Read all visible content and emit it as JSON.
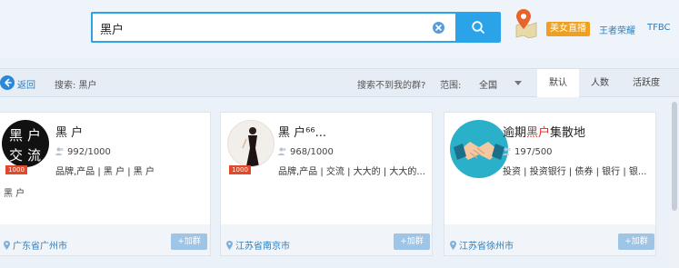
{
  "search": {
    "value": "黑户"
  },
  "top_links": {
    "live_badge": "美女直播",
    "link1": "王者荣耀",
    "link2": "TFBC"
  },
  "filter": {
    "back_label": "返回",
    "search_label": "搜索: 黑户",
    "not_found": "搜索不到我的群?",
    "range_label": "范围:",
    "range_value": "全国",
    "sort_tabs": [
      "默认",
      "人数",
      "活跃度"
    ]
  },
  "cards": [
    {
      "name": "黑  户",
      "members": "992/1000",
      "tags": "品牌,产品 | 黑  户 | 黑  户",
      "desc": "黑  户",
      "location": "广东省广州市",
      "join": "+加群",
      "avatar_text": "黑户交流",
      "level": "1000"
    },
    {
      "name": "黑  户⁶⁶",
      "name_suffix": "...",
      "members": "968/1000",
      "tags": "品牌,产品 | 交流 | 大大的 | 大大的...",
      "location": "江苏省南京市",
      "join": "+加群",
      "level": "1000"
    },
    {
      "name_prefix": "逾期",
      "name_highlight": "黑户",
      "name_suffix": "集散地",
      "members": "197/500",
      "tags": "投资 | 投资银行 | 债券 | 银行 | 银...",
      "location": "江苏省徐州市",
      "join": "+加群"
    }
  ],
  "colors": {
    "accent": "#2aa3e8",
    "highlight": "#e02a1a",
    "badge": "#f0a020"
  }
}
